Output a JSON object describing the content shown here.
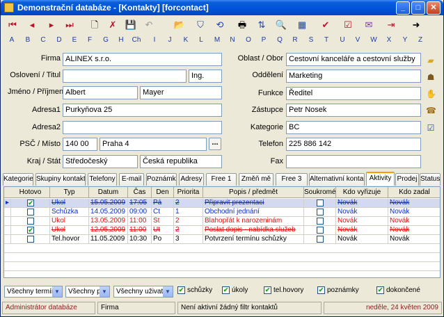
{
  "window": {
    "title": "Demonstrační databáze - [Kontakty] [forcontact]"
  },
  "alphabet": [
    "A",
    "B",
    "C",
    "D",
    "E",
    "F",
    "G",
    "H",
    "Ch",
    "I",
    "J",
    "K",
    "L",
    "M",
    "N",
    "O",
    "P",
    "Q",
    "R",
    "S",
    "T",
    "U",
    "V",
    "W",
    "X",
    "Y",
    "Z"
  ],
  "form": {
    "firma_label": "Firma",
    "firma": "ALINEX s.r.o.",
    "osloveni_label": "Oslovení / Titul",
    "osloveni": "",
    "titul": "Ing.",
    "jmeno_label": "Jméno / Příjmení",
    "jmeno": "Albert",
    "prijmeni": "Mayer",
    "adresa1_label": "Adresa1",
    "adresa1": "Purkyňova 25",
    "adresa2_label": "Adresa2",
    "adresa2": "",
    "psc_label": "PSČ / Místo",
    "psc": "140 00",
    "misto": "Praha 4",
    "kraj_label": "Kraj / Stát",
    "kraj": "Středočeský",
    "stat": "Česká republika",
    "oblast_label": "Oblast / Obor",
    "oblast": "Cestovní kanceláře a cestovní služby",
    "oddeleni_label": "Oddělení",
    "oddeleni": "Marketing",
    "funkce_label": "Funkce",
    "funkce": "Ředitel",
    "zastupce_label": "Zástupce",
    "zastupce": "Petr Nosek",
    "kategorie_label": "Kategorie",
    "kategorie": "BC",
    "telefon_label": "Telefon",
    "telefon": "225 886 142",
    "fax_label": "Fax",
    "fax": "",
    "dots": "..."
  },
  "tabs": [
    "Kategorie",
    "Skupiny kontaktů",
    "Telefony",
    "E-mail",
    "Poznámka",
    "Adresy",
    "Free 1",
    "Změň mě",
    "Free 3",
    "Alternativní kontakty",
    "Aktivity",
    "Prodej",
    "Status"
  ],
  "grid": {
    "headers": [
      "Hotovo",
      "Typ",
      "Datum",
      "Čas",
      "Den",
      "Priorita",
      "Popis / předmět",
      "Soukromé",
      "Kdo vyřizuje",
      "Kdo zadal"
    ],
    "rows": [
      {
        "hotovo": true,
        "typ": "Úkol",
        "datum": "15.05.2009",
        "cas": "17:05",
        "den": "Pá",
        "priorita": "2",
        "popis": "Připravit prezentaci",
        "soukrome": false,
        "vyrizuje": "Novák",
        "zadal": "Novák"
      },
      {
        "hotovo": false,
        "typ": "Schůzka",
        "datum": "14.05.2009",
        "cas": "09:00",
        "den": "Čt",
        "priorita": "1",
        "popis": "Obchodní jednání",
        "soukrome": false,
        "vyrizuje": "Novák",
        "zadal": "Novák"
      },
      {
        "hotovo": false,
        "typ": "Úkol",
        "datum": "13.05.2009",
        "cas": "11:00",
        "den": "St",
        "priorita": "2",
        "popis": "Blahopřát k narozeninám",
        "soukrome": false,
        "vyrizuje": "Novák",
        "zadal": "Novák"
      },
      {
        "hotovo": true,
        "typ": "Úkol",
        "datum": "12.05.2009",
        "cas": "11:00",
        "den": "Út",
        "priorita": "2",
        "popis": "Poslat dopis - nabídka služeb",
        "soukrome": false,
        "vyrizuje": "Novák",
        "zadal": "Novák"
      },
      {
        "hotovo": false,
        "typ": "Tel.hovor",
        "datum": "11.05.2009",
        "cas": "10:30",
        "den": "Po",
        "priorita": "3",
        "popis": "Potvrzení termínu schůzky",
        "soukrome": false,
        "vyrizuje": "Novák",
        "zadal": "Novák"
      }
    ]
  },
  "filters": {
    "terminy": "Všechny termíny",
    "priority": "Všechny pr",
    "uzivatele": "Všechny uživatele",
    "schuzky": "schůzky",
    "ukoly": "úkoly",
    "telhovory": "tel.hovory",
    "poznamky": "poznámky",
    "dokoncene": "dokončené"
  },
  "status": {
    "user": "Administrátor databáze",
    "field": "Firma",
    "filter": "Není aktivní žádný filtr kontaktů",
    "date": "neděle, 24 květen 2009"
  },
  "colors": {
    "titlebar": "#0053d9",
    "link_blue": "#0b2fc7",
    "red": "#e01010",
    "selection": "#d3daf0"
  }
}
